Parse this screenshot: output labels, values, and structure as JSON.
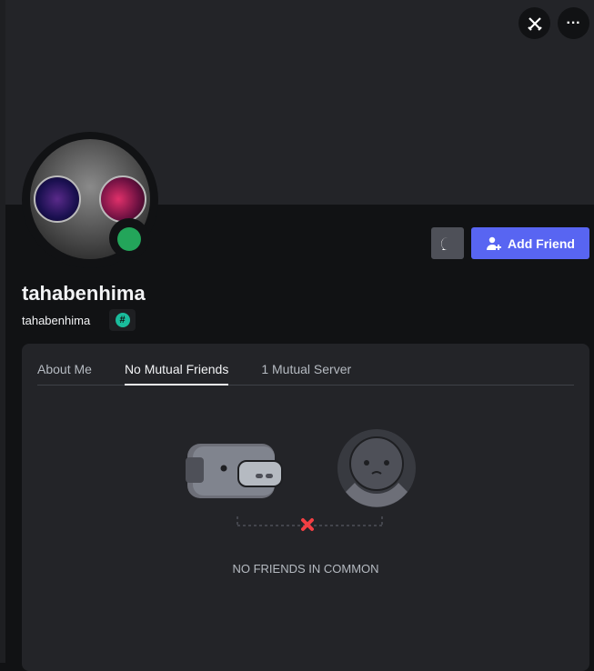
{
  "header": {
    "top_buttons": [
      {
        "icon": "swords-icon"
      },
      {
        "icon": "more-icon",
        "label": "···"
      }
    ]
  },
  "profile": {
    "display_name": "tahabenhima",
    "username": "tahabenhima",
    "badge_icon": "#",
    "status": "online",
    "status_color": "#23a55a",
    "add_friend_label": "Add Friend",
    "accent": "#5865f2"
  },
  "tabs": [
    {
      "label": "About Me"
    },
    {
      "label": "No Mutual Friends",
      "active": true
    },
    {
      "label": "1 Mutual Server"
    }
  ],
  "empty_state": {
    "text": "NO FRIENDS IN COMMON"
  }
}
